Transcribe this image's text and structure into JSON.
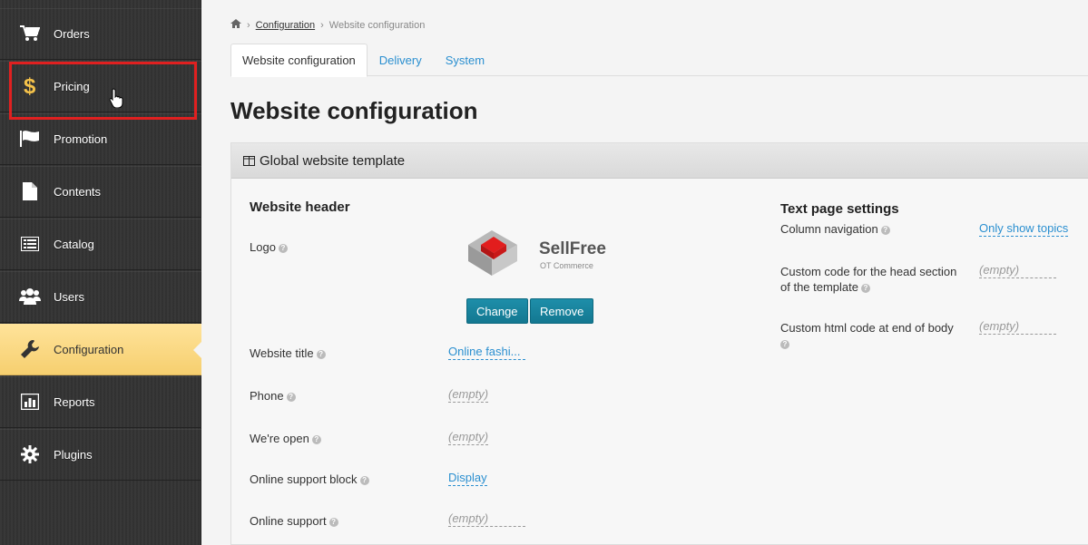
{
  "sidebar": {
    "items": [
      {
        "label": "Orders",
        "icon": "cart-icon"
      },
      {
        "label": "Pricing",
        "icon": "dollar-icon"
      },
      {
        "label": "Promotion",
        "icon": "flag-icon"
      },
      {
        "label": "Contents",
        "icon": "document-icon"
      },
      {
        "label": "Catalog",
        "icon": "list-icon"
      },
      {
        "label": "Users",
        "icon": "users-icon"
      },
      {
        "label": "Configuration",
        "icon": "wrench-icon"
      },
      {
        "label": "Reports",
        "icon": "bar-chart-icon"
      },
      {
        "label": "Plugins",
        "icon": "gear-icon"
      }
    ],
    "active": "Configuration",
    "highlight_color": "#e02020",
    "active_color": "#f6cf6f",
    "dollar_color": "#f5c24a"
  },
  "breadcrumb": {
    "home_icon": "home-icon",
    "link": "Configuration",
    "current": "Website configuration"
  },
  "tabs": [
    "Website configuration",
    "Delivery",
    "System"
  ],
  "page_title": "Website configuration",
  "panel": {
    "title": "Global website template",
    "header": {
      "title": "Website header",
      "logo_label": "Logo",
      "logo_text": "SellFree",
      "logo_subtext": "OT Commerce",
      "change_button": "Change",
      "remove_button": "Remove",
      "rows": [
        {
          "label": "Website title",
          "value": "Online fashi...",
          "empty": false
        },
        {
          "label": "Phone",
          "value": "(empty)",
          "empty": true
        },
        {
          "label": "We're open",
          "value": "(empty)",
          "empty": true
        },
        {
          "label": "Online support block",
          "value": "Display",
          "empty": false
        },
        {
          "label": "Online support",
          "value": "(empty)",
          "empty": true
        }
      ]
    },
    "text_page": {
      "title": "Text page settings",
      "column_nav_label": "Column navigation",
      "column_nav_value": "Only show topics",
      "head_code_label_1": "Custom code for the head section",
      "head_code_label_2": "of the template",
      "head_code_value": "(empty)",
      "body_code_label": "Custom html code at end of body",
      "body_code_value": "(empty)"
    }
  },
  "colors": {
    "link": "#2a8fd0",
    "button": "#137891",
    "sidebar": "#333333"
  }
}
